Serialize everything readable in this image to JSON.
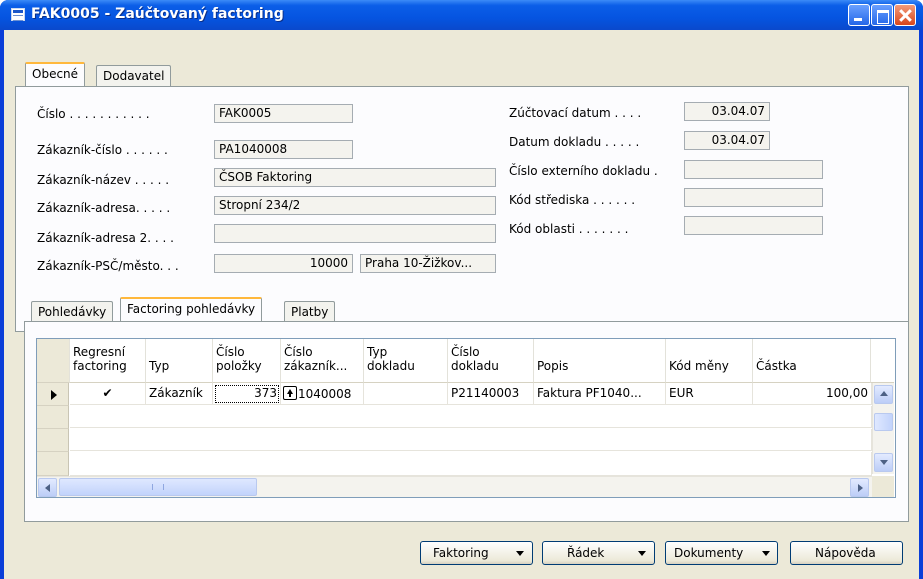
{
  "window": {
    "title": "FAK0005 - Zaúčtovaný factoring"
  },
  "header_tabs": [
    {
      "label": "Obecné",
      "active": true
    },
    {
      "label": "Dodavatel",
      "active": false
    }
  ],
  "general": {
    "left": [
      {
        "label": "Číslo . . . . . . . . . . .",
        "value": "FAK0005"
      },
      {
        "label": "Zákazník-číslo . . . . . .",
        "value": "PA1040008"
      },
      {
        "label": "Zákazník-název . . . . .",
        "value": "ČSOB Faktoring"
      },
      {
        "label": "Zákazník-adresa. . . . .",
        "value": "Stropní 234/2"
      },
      {
        "label": "Zákazník-adresa 2. . . .",
        "value": ""
      },
      {
        "label": "Zákazník-PSČ/město. . .",
        "postcode": "10000",
        "city": "Praha 10-Žižkov..."
      }
    ],
    "right": [
      {
        "label": "Zúčtovací datum . . . .",
        "value": "03.04.07"
      },
      {
        "label": "Datum dokladu . . . . .",
        "value": "03.04.07"
      },
      {
        "label": "Číslo externího dokladu .",
        "value": ""
      },
      {
        "label": "Kód střediska . . . . . .",
        "value": ""
      },
      {
        "label": "Kód oblasti . . . . . . .",
        "value": ""
      }
    ]
  },
  "lines_tabs": [
    {
      "label": "Pohledávky",
      "active": false
    },
    {
      "label": "Factoring pohledávky",
      "active": true
    },
    {
      "label": "Platby",
      "active": false
    }
  ],
  "grid": {
    "columns": [
      {
        "line1": "Regresní",
        "line2": "factoring"
      },
      {
        "line1": "",
        "line2": "Typ"
      },
      {
        "line1": "Číslo",
        "line2": "položky"
      },
      {
        "line1": "Číslo",
        "line2": "zákazník..."
      },
      {
        "line1": "Typ",
        "line2": "dokladu"
      },
      {
        "line1": "Číslo",
        "line2": "dokladu"
      },
      {
        "line1": "",
        "line2": "Popis"
      },
      {
        "line1": "",
        "line2": "Kód měny"
      },
      {
        "line1": "",
        "line2": "Částka"
      }
    ],
    "rows": [
      {
        "regresni": "✔",
        "typ": "Zákazník",
        "cislo_polozky": "373",
        "cislo_zakaznika": "1040008",
        "typ_dokladu": "",
        "cislo_dokladu": "P21140003",
        "popis": "Faktura PF1040...",
        "kod_meny": "EUR",
        "castka": "100,00"
      }
    ]
  },
  "buttons": {
    "factoring": "Faktoring",
    "radek": "Řádek",
    "dokumenty": "Dokumenty",
    "napoveda": "Nápověda"
  },
  "colors": {
    "titlebar": "#0554e0",
    "face": "#ece9d8",
    "active_tab_accent": "#ffb83c"
  }
}
